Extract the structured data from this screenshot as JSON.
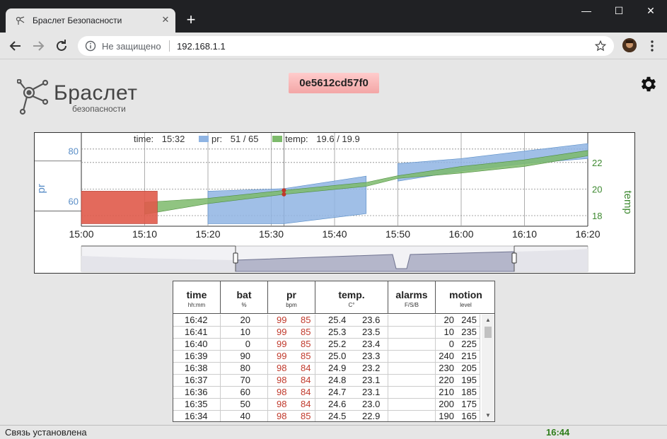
{
  "browser": {
    "tab_title": "Браслет Безопасности",
    "tab_close": "✕",
    "new_tab": "+",
    "security_label": "Не защищено",
    "url": "192.168.1.1",
    "window_controls": {
      "minimize": "—",
      "maximize": "☐",
      "close": "✕"
    }
  },
  "header": {
    "logo_title": "Браслет",
    "logo_subtitle": "безопасности",
    "device_id": "0e5612cd57f0"
  },
  "chart": {
    "legend": {
      "time_label": "time:",
      "time_value": "15:32",
      "pr_label": "pr:",
      "pr_value": "51 / 65",
      "temp_label": "temp:",
      "temp_value": "19.6 / 19.9"
    },
    "left_axis_title": "pr",
    "right_axis_title": "temp",
    "colors": {
      "pr": "#8fb4e3",
      "pr_alarm": "#e05a4a",
      "temp": "#7dba6b",
      "left_axis_text": "#5a8ec7",
      "right_axis_text": "#3f8a32"
    }
  },
  "chart_data": {
    "type": "area",
    "x_ticks": [
      "15:00",
      "15:10",
      "15:20",
      "15:30",
      "15:40",
      "15:50",
      "16:00",
      "16:10",
      "16:20"
    ],
    "cursor_time": "15:32",
    "left_axis": {
      "label": "pr",
      "ticks": [
        60,
        80
      ],
      "range": [
        50,
        85
      ]
    },
    "right_axis": {
      "label": "temp",
      "ticks": [
        18,
        20,
        22
      ],
      "range": [
        17.2,
        23.8
      ]
    },
    "series": [
      {
        "name": "pr",
        "band": true,
        "points": [
          {
            "t": "15:00",
            "min": 60,
            "max": 62
          },
          {
            "t": "15:10",
            "min": 60,
            "max": 62
          },
          {
            "t": "15:20",
            "min": 51,
            "max": 64
          },
          {
            "t": "15:32",
            "min": 51,
            "max": 65
          },
          {
            "t": "15:45",
            "min": 55,
            "max": 70
          },
          {
            "t": "15:50",
            "min": 68,
            "max": 75
          },
          {
            "t": "16:00",
            "min": 72,
            "max": 77
          },
          {
            "t": "16:10",
            "min": 75,
            "max": 80
          },
          {
            "t": "16:20",
            "min": 77,
            "max": 83
          }
        ]
      },
      {
        "name": "temp",
        "band": true,
        "points": [
          {
            "t": "15:10",
            "min": 18.1,
            "max": 19.0
          },
          {
            "t": "15:20",
            "min": 18.9,
            "max": 19.3
          },
          {
            "t": "15:32",
            "min": 19.6,
            "max": 19.9
          },
          {
            "t": "15:45",
            "min": 20.2,
            "max": 20.5
          },
          {
            "t": "15:50",
            "min": 20.8,
            "max": 21.0
          },
          {
            "t": "16:00",
            "min": 21.2,
            "max": 21.7
          },
          {
            "t": "16:10",
            "min": 21.7,
            "max": 22.2
          },
          {
            "t": "16:20",
            "min": 22.5,
            "max": 22.9
          }
        ]
      }
    ],
    "alarm_range": [
      "15:00",
      "15:12"
    ],
    "grid": true
  },
  "table": {
    "columns": [
      {
        "name": "time",
        "unit": "hh:mm"
      },
      {
        "name": "bat",
        "unit": "%"
      },
      {
        "name": "pr",
        "unit": "bpm"
      },
      {
        "name": "temp.",
        "unit": "C°"
      },
      {
        "name": "alarms",
        "unit": "F/S/B"
      },
      {
        "name": "motion",
        "unit": "level"
      }
    ],
    "rows": [
      {
        "time": "16:42",
        "bat": "20",
        "pr1": "99",
        "pr2": "85",
        "t1": "25.4",
        "t2": "23.6",
        "alarms": "",
        "m1": "20",
        "m2": "245"
      },
      {
        "time": "16:41",
        "bat": "10",
        "pr1": "99",
        "pr2": "85",
        "t1": "25.3",
        "t2": "23.5",
        "alarms": "",
        "m1": "10",
        "m2": "235"
      },
      {
        "time": "16:40",
        "bat": "0",
        "pr1": "99",
        "pr2": "85",
        "t1": "25.2",
        "t2": "23.4",
        "alarms": "",
        "m1": "0",
        "m2": "225"
      },
      {
        "time": "16:39",
        "bat": "90",
        "pr1": "99",
        "pr2": "85",
        "t1": "25.0",
        "t2": "23.3",
        "alarms": "",
        "m1": "240",
        "m2": "215"
      },
      {
        "time": "16:38",
        "bat": "80",
        "pr1": "98",
        "pr2": "84",
        "t1": "24.9",
        "t2": "23.2",
        "alarms": "",
        "m1": "230",
        "m2": "205"
      },
      {
        "time": "16:37",
        "bat": "70",
        "pr1": "98",
        "pr2": "84",
        "t1": "24.8",
        "t2": "23.1",
        "alarms": "",
        "m1": "220",
        "m2": "195"
      },
      {
        "time": "16:36",
        "bat": "60",
        "pr1": "98",
        "pr2": "84",
        "t1": "24.7",
        "t2": "23.1",
        "alarms": "",
        "m1": "210",
        "m2": "185"
      },
      {
        "time": "16:35",
        "bat": "50",
        "pr1": "98",
        "pr2": "84",
        "t1": "24.6",
        "t2": "23.0",
        "alarms": "",
        "m1": "200",
        "m2": "175"
      },
      {
        "time": "16:34",
        "bat": "40",
        "pr1": "98",
        "pr2": "85",
        "t1": "24.5",
        "t2": "22.9",
        "alarms": "",
        "m1": "190",
        "m2": "165"
      }
    ]
  },
  "status": {
    "connection": "Связь установлена",
    "time": "16:44"
  }
}
